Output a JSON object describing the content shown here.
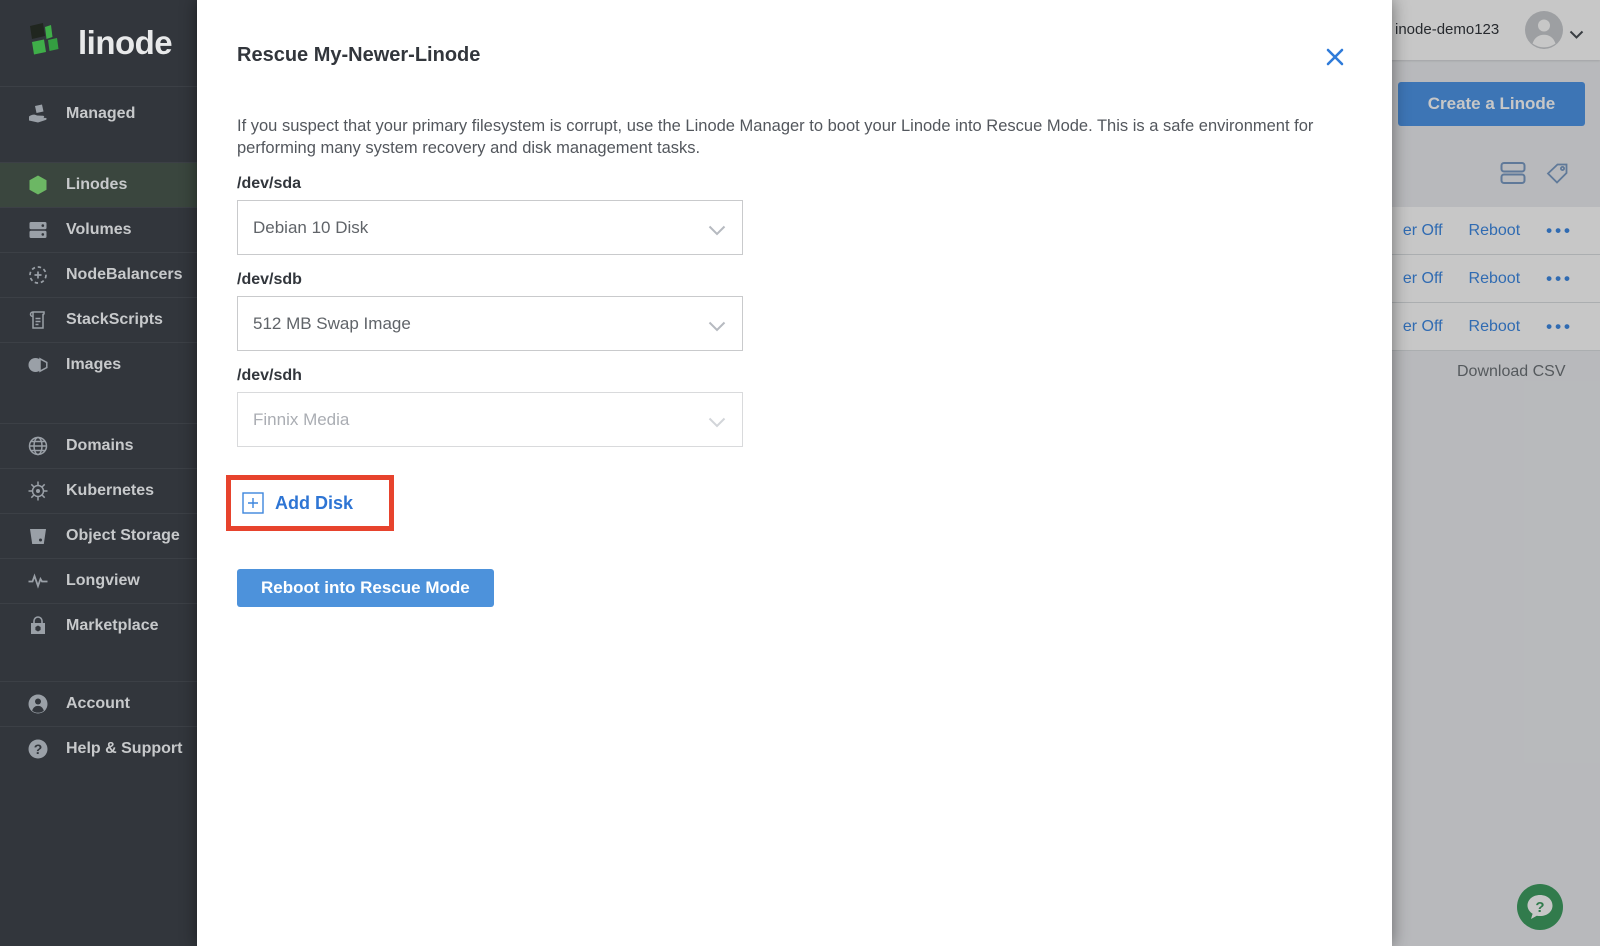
{
  "colors": {
    "accent_blue": "#3683dc",
    "brand_green": "#3fae49",
    "annotation_red": "#e7432d",
    "sidebar_bg": "#32363c",
    "sidebar_selected_bg": "#3a463e",
    "help_beacon_green": "#3f9e62"
  },
  "sidebar": {
    "logo_text": "linode",
    "items": [
      {
        "label": "Managed"
      },
      {
        "label": "Linodes"
      },
      {
        "label": "Volumes"
      },
      {
        "label": "NodeBalancers"
      },
      {
        "label": "StackScripts"
      },
      {
        "label": "Images"
      },
      {
        "label": "Domains"
      },
      {
        "label": "Kubernetes"
      },
      {
        "label": "Object Storage"
      },
      {
        "label": "Longview"
      },
      {
        "label": "Marketplace"
      },
      {
        "label": "Account"
      },
      {
        "label": "Help & Support"
      }
    ]
  },
  "topbar": {
    "username": "inode-demo123"
  },
  "background": {
    "create_button_label": "Create a Linode",
    "rows": [
      {
        "power_label": "er Off",
        "reboot_label": "Reboot",
        "more_label": "•••"
      },
      {
        "power_label": "er Off",
        "reboot_label": "Reboot",
        "more_label": "•••"
      },
      {
        "power_label": "er Off",
        "reboot_label": "Reboot",
        "more_label": "•••"
      }
    ],
    "download_csv_label": "Download CSV"
  },
  "modal": {
    "title": "Rescue My-Newer-Linode",
    "description": "If you suspect that your primary filesystem is corrupt, use the Linode Manager to boot your Linode into Rescue Mode. This is a safe environment for performing many system recovery and disk management tasks.",
    "fields": [
      {
        "label": "/dev/sda",
        "value": "Debian 10 Disk"
      },
      {
        "label": "/dev/sdb",
        "value": "512 MB Swap Image"
      },
      {
        "label": "/dev/sdh",
        "value": "Finnix Media"
      }
    ],
    "add_disk_label": "Add Disk",
    "submit_label": "Reboot into Rescue Mode"
  }
}
